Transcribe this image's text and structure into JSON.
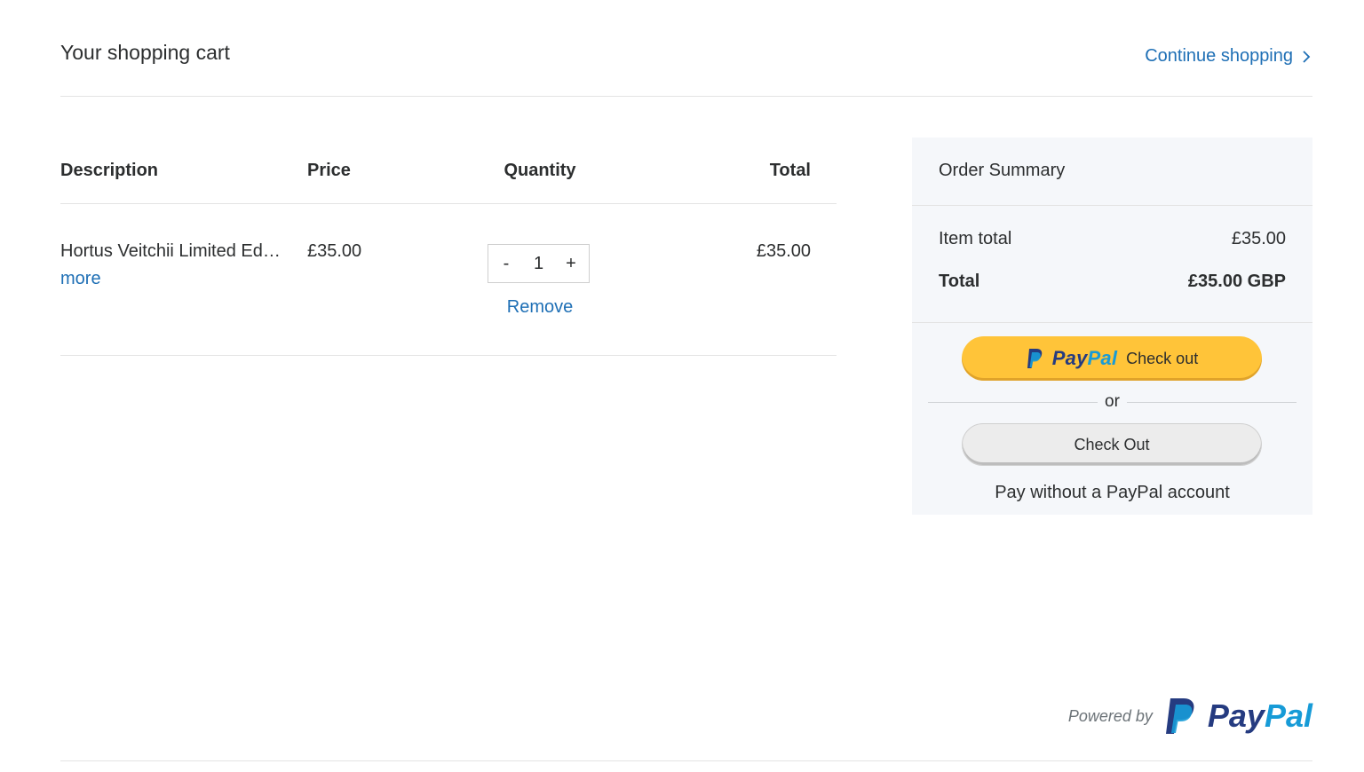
{
  "header": {
    "title": "Your shopping cart",
    "continue_label": "Continue shopping",
    "continue_icon": "chevron-right-icon"
  },
  "cart": {
    "columns": [
      "Description",
      "Price",
      "Quantity",
      "Total"
    ],
    "items": [
      {
        "name": "Hortus Veitchii Limited Edition",
        "more": "more",
        "price": "£35.00",
        "quantity": "1",
        "decrement": "-",
        "increment": "+",
        "remove": "Remove",
        "total": "£35.00"
      }
    ]
  },
  "summary": {
    "title": "Order Summary",
    "item_total_label": "Item total",
    "item_total_value": "£35.00",
    "total_label": "Total",
    "total_value": "£35.00 GBP",
    "paypal_pay": "Pay",
    "paypal_pal": "Pal",
    "paypal_checkout": "Check out",
    "or": "or",
    "checkout_label": "Check Out",
    "no_account": "Pay without a PayPal account"
  },
  "footer": {
    "powered_by": "Powered by",
    "logo_pay": "Pay",
    "logo_pal": "Pal"
  },
  "colors": {
    "link": "#1e6fb5",
    "paypal_yellow": "#ffc439",
    "paypal_dark_blue": "#253b80",
    "paypal_light_blue": "#179bd7",
    "summary_bg": "#f5f7fa"
  }
}
